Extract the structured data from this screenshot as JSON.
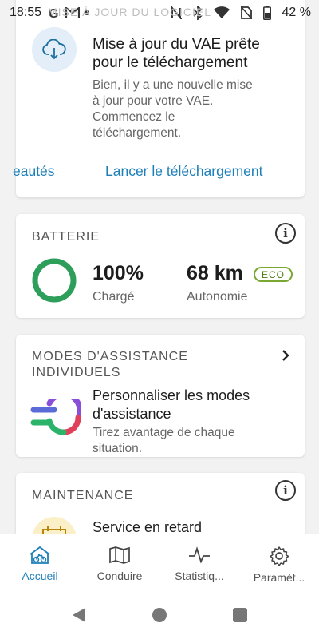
{
  "status_bar": {
    "time": "18:55",
    "ghost_title": "MISE À JOUR DU LOGICIEL",
    "battery_percent": "42 %",
    "icons": [
      "google-icon",
      "gmail-icon",
      "dot-icon",
      "nfc-icon",
      "bluetooth-icon",
      "wifi-icon",
      "no-sim-icon",
      "battery-icon"
    ]
  },
  "update_card": {
    "title": "Mise à jour du VAE prête pour le téléchargement",
    "body": "Bien, il y a une nouvelle mise à jour pour votre VAE. Commencez le téléchargement.",
    "link_left": "eautés",
    "link_right": "Lancer le téléchargement",
    "icon": "cloud-download-icon"
  },
  "battery_card": {
    "title": "BATTERIE",
    "charge_value": "100%",
    "charge_label": "Chargé",
    "range_value": "68 km",
    "range_label": "Autonomie",
    "mode_badge": "ECO",
    "charge_fraction": 1.0,
    "ring_color": "#2e9e5b"
  },
  "modes_card": {
    "title": "MODES D'ASSISTANCE INDIVIDUELS",
    "heading": "Personnaliser les modes d'assistance",
    "body": "Tirez avantage de chaque situation."
  },
  "maintenance_card": {
    "title": "MAINTENANCE",
    "heading": "Service en retard"
  },
  "bottom_nav": [
    {
      "label": "Accueil",
      "icon": "home-bike-icon",
      "active": true
    },
    {
      "label": "Conduire",
      "icon": "map-icon",
      "active": false
    },
    {
      "label": "Statistiq...",
      "icon": "activity-icon",
      "active": false
    },
    {
      "label": "Paramèt...",
      "icon": "gear-icon",
      "active": false
    }
  ],
  "colors": {
    "accent": "#1d7fb8",
    "battery_ring": "#2e9e5b",
    "eco_badge": "#7aa832"
  }
}
